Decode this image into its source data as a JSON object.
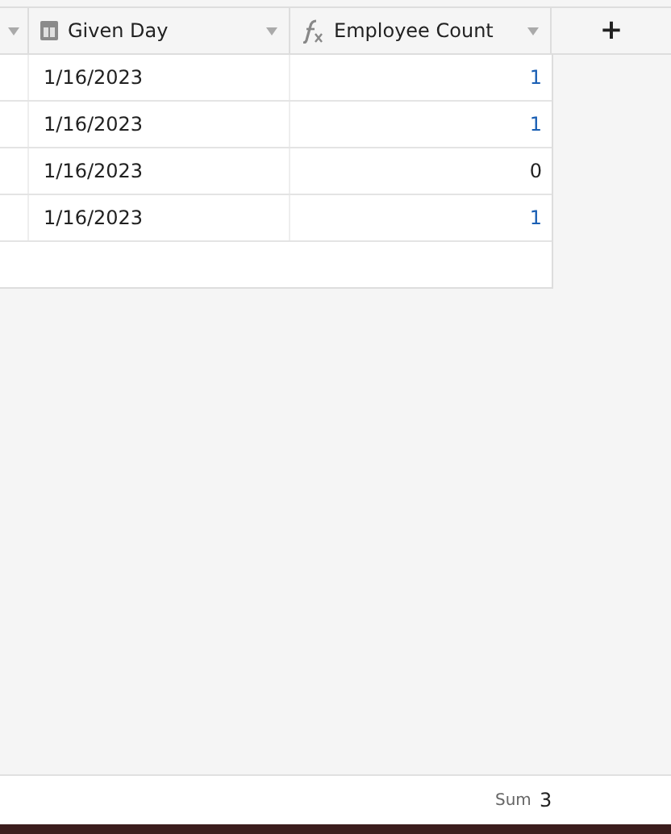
{
  "columns": [
    {
      "label": "Given Day",
      "kind": "date"
    },
    {
      "label": "Employee Count",
      "kind": "formula"
    }
  ],
  "add_column": {
    "label": "+"
  },
  "rows": [
    {
      "given_day": "1/16/2023",
      "employee_count": "1",
      "color": "#1a5fb4"
    },
    {
      "given_day": "1/16/2023",
      "employee_count": "1",
      "color": "#1a5fb4"
    },
    {
      "given_day": "1/16/2023",
      "employee_count": "0",
      "color": "#212121"
    },
    {
      "given_day": "1/16/2023",
      "employee_count": "1",
      "color": "#1a5fb4"
    }
  ],
  "footer": {
    "label": "Sum",
    "value": "3"
  }
}
